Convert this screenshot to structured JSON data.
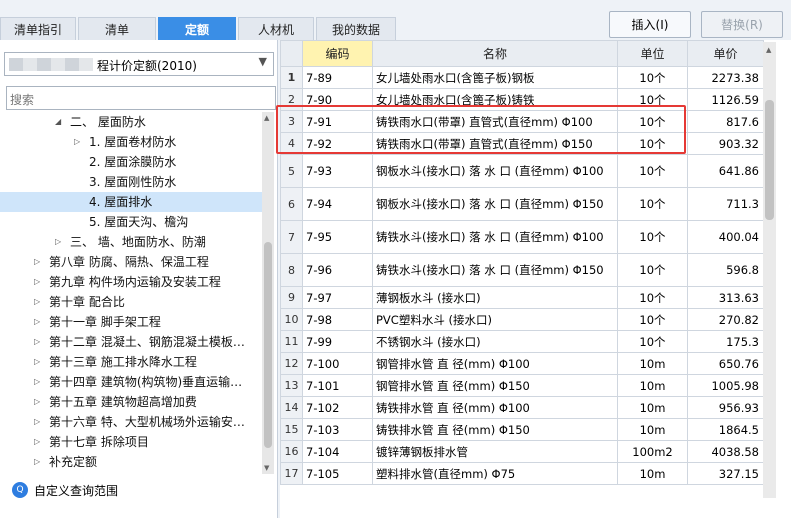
{
  "tabs": [
    {
      "label": "清单指引"
    },
    {
      "label": "清单"
    },
    {
      "label": "定额"
    },
    {
      "label": "人材机"
    },
    {
      "label": "我的数据"
    }
  ],
  "toolbar": {
    "insert_label": "插入(I)",
    "replace_label": "替换(R)"
  },
  "quota_select": {
    "value": "程计价定额(2010)"
  },
  "search": {
    "placeholder": "搜索"
  },
  "tree": [
    {
      "label": "二、 屋面防水",
      "level": 2,
      "expand": "down"
    },
    {
      "label": "1.  屋面卷材防水",
      "level": 3,
      "expand": "right"
    },
    {
      "label": "2.  屋面涂膜防水",
      "level": 3,
      "expand": ""
    },
    {
      "label": "3.  屋面刚性防水",
      "level": 3,
      "expand": ""
    },
    {
      "label": "4.  屋面排水",
      "level": 3,
      "expand": "",
      "selected": true
    },
    {
      "label": "5.  屋面天沟、檐沟",
      "level": 3,
      "expand": ""
    },
    {
      "label": "三、 墙、地面防水、防潮",
      "level": 2,
      "expand": "right"
    },
    {
      "label": "第八章 防腐、隔热、保温工程",
      "level": 1,
      "expand": "right"
    },
    {
      "label": "第九章 构件场内运输及安装工程",
      "level": 1,
      "expand": "right"
    },
    {
      "label": "第十章 配合比",
      "level": 1,
      "expand": "right"
    },
    {
      "label": "第十一章 脚手架工程",
      "level": 1,
      "expand": "right"
    },
    {
      "label": "第十二章 混凝土、钢筋混凝土模板…",
      "level": 1,
      "expand": "right"
    },
    {
      "label": "第十三章 施工排水降水工程",
      "level": 1,
      "expand": "right"
    },
    {
      "label": "第十四章 建筑物(构筑物)垂直运输…",
      "level": 1,
      "expand": "right"
    },
    {
      "label": "第十五章 建筑物超高增加费",
      "level": 1,
      "expand": "right"
    },
    {
      "label": "第十六章 特、大型机械场外运输安…",
      "level": 1,
      "expand": "right"
    },
    {
      "label": "第十七章 拆除项目",
      "level": 1,
      "expand": "right"
    },
    {
      "label": "补充定额",
      "level": 1,
      "expand": "right"
    }
  ],
  "footer": {
    "label": "自定义查询范围"
  },
  "grid": {
    "headers": {
      "code": "编码",
      "name": "名称",
      "unit": "单位",
      "price": "单价"
    },
    "rows": [
      {
        "idx": "1",
        "code": "7-89",
        "name": "女儿墙处雨水口(含篦子板)钢板",
        "unit": "10个",
        "price": "2273.38"
      },
      {
        "idx": "2",
        "code": "7-90",
        "name": "女儿墙处雨水口(含篦子板)铸铁",
        "unit": "10个",
        "price": "1126.59"
      },
      {
        "idx": "3",
        "code": "7-91",
        "name": "铸铁雨水口(带罩) 直管式(直径mm) Φ100",
        "unit": "10个",
        "price": "817.6"
      },
      {
        "idx": "4",
        "code": "7-92",
        "name": "铸铁雨水口(带罩) 直管式(直径mm) Φ150",
        "unit": "10个",
        "price": "903.32"
      },
      {
        "idx": "5",
        "code": "7-93",
        "name": "钢板水斗(接水口) 落 水 口 (直径mm) Φ100",
        "unit": "10个",
        "price": "641.86"
      },
      {
        "idx": "6",
        "code": "7-94",
        "name": "钢板水斗(接水口) 落 水 口 (直径mm) Φ150",
        "unit": "10个",
        "price": "711.3"
      },
      {
        "idx": "7",
        "code": "7-95",
        "name": "铸铁水斗(接水口) 落 水 口 (直径mm) Φ100",
        "unit": "10个",
        "price": "400.04"
      },
      {
        "idx": "8",
        "code": "7-96",
        "name": "铸铁水斗(接水口) 落 水 口 (直径mm) Φ150",
        "unit": "10个",
        "price": "596.8"
      },
      {
        "idx": "9",
        "code": "7-97",
        "name": "薄钢板水斗 (接水口)",
        "unit": "10个",
        "price": "313.63"
      },
      {
        "idx": "10",
        "code": "7-98",
        "name": "PVC塑料水斗 (接水口)",
        "unit": "10个",
        "price": "270.82"
      },
      {
        "idx": "11",
        "code": "7-99",
        "name": "不锈钢水斗 (接水口)",
        "unit": "10个",
        "price": "175.3"
      },
      {
        "idx": "12",
        "code": "7-100",
        "name": "钢管排水管 直 径(mm) Φ100",
        "unit": "10m",
        "price": "650.76"
      },
      {
        "idx": "13",
        "code": "7-101",
        "name": "钢管排水管 直 径(mm) Φ150",
        "unit": "10m",
        "price": "1005.98"
      },
      {
        "idx": "14",
        "code": "7-102",
        "name": "铸铁排水管 直 径(mm) Φ100",
        "unit": "10m",
        "price": "956.93"
      },
      {
        "idx": "15",
        "code": "7-103",
        "name": "铸铁排水管 直 径(mm) Φ150",
        "unit": "10m",
        "price": "1864.5"
      },
      {
        "idx": "16",
        "code": "7-104",
        "name": "镀锌薄钢板排水管",
        "unit": "100m2",
        "price": "4038.58"
      },
      {
        "idx": "17",
        "code": "7-105",
        "name": "塑料排水管(直径mm) Φ75",
        "unit": "10m",
        "price": "327.15"
      }
    ]
  },
  "colors": {
    "accent": "#3a8ee6",
    "highlight_box": "#e53935",
    "selected_tree_bg": "#cfe5fa",
    "code_header_bg": "#fff3b0"
  }
}
